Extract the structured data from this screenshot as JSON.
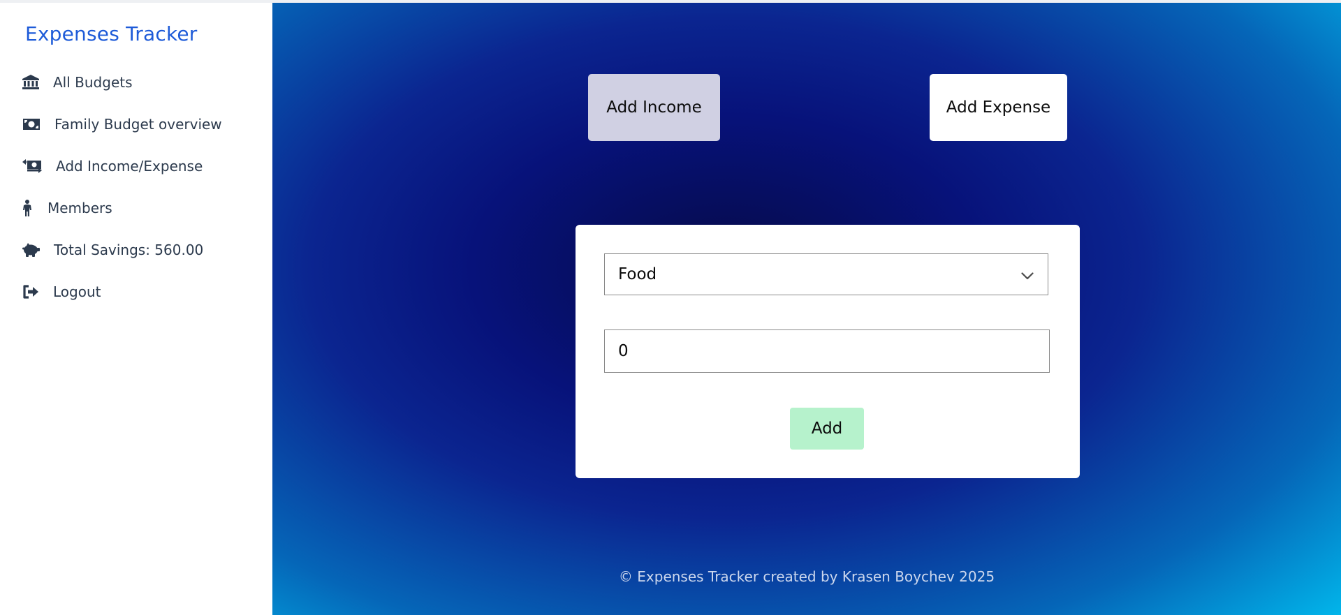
{
  "app": {
    "title": "Expenses Tracker"
  },
  "sidebar": {
    "items": [
      {
        "label": "All Budgets",
        "icon": "bank-icon"
      },
      {
        "label": "Family Budget overview",
        "icon": "money-bill-icon"
      },
      {
        "label": "Add Income/Expense",
        "icon": "money-transfer-icon"
      },
      {
        "label": "Members",
        "icon": "person-icon"
      },
      {
        "label": "Total Savings: 560.00",
        "icon": "piggy-bank-icon"
      },
      {
        "label": "Logout",
        "icon": "logout-icon"
      }
    ]
  },
  "actions": {
    "add_income_label": "Add Income",
    "add_expense_label": "Add Expense",
    "active": "income"
  },
  "form": {
    "category": {
      "selected": "Food"
    },
    "amount": {
      "value": "0"
    },
    "submit_label": "Add"
  },
  "footer": {
    "text": "© Expenses Tracker created by Krasen Boychev 2025"
  },
  "colors": {
    "brand": "#1e5bd8",
    "sidebar_text": "#2c3a4d",
    "active_button": "#d0d0e3",
    "submit_button": "#b6f2cc"
  }
}
